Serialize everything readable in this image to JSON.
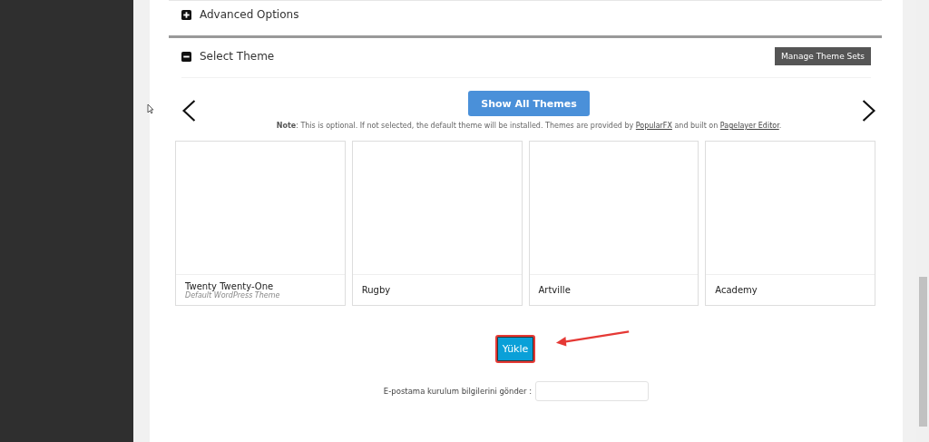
{
  "sections": [
    {
      "title": "Advanced Options",
      "expanded": false
    },
    {
      "title": "Select Theme",
      "expanded": true
    }
  ],
  "manage_button": "Manage Theme Sets",
  "show_all_button": "Show All Themes",
  "note": [
    {
      "kind": "bold",
      "text": "Note"
    },
    {
      "kind": "text",
      "text": ": This is optional. If not selected, the default theme will be installed. Themes are provided by "
    },
    {
      "kind": "link",
      "text": "PopularFX"
    },
    {
      "kind": "text",
      "text": " and built on "
    },
    {
      "kind": "link",
      "text": "Pagelayer Editor"
    },
    {
      "kind": "text",
      "text": "."
    }
  ],
  "themes": [
    {
      "name": "Twenty Twenty-One",
      "subtitle": "Default WordPress Theme"
    },
    {
      "name": "Rugby"
    },
    {
      "name": "Artville"
    },
    {
      "name": "Academy"
    }
  ],
  "install_button": "Yükle",
  "email_label": "E-postama kurulum bilgilerini gönder :"
}
